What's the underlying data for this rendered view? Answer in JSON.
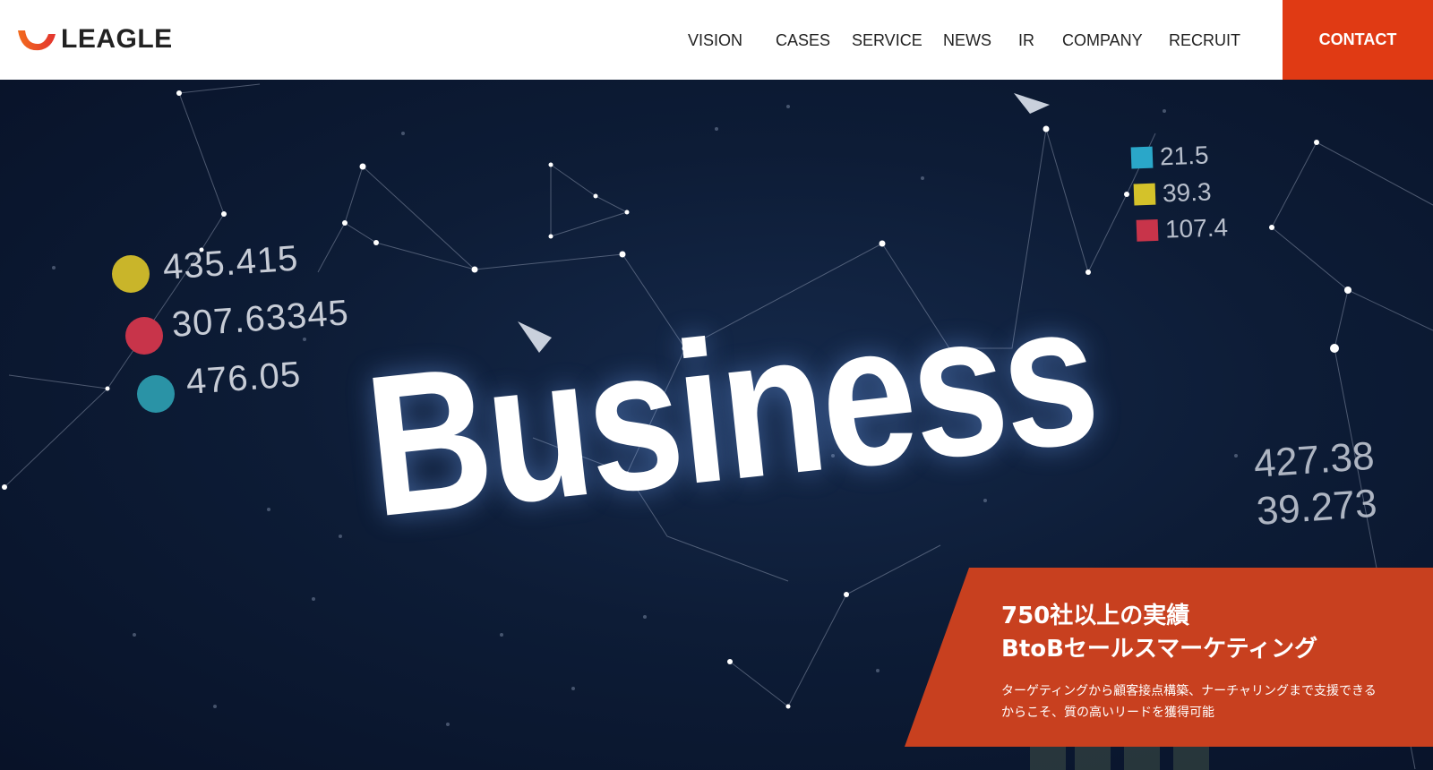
{
  "brand": {
    "name": "LEAGLE",
    "colors": {
      "accent": "#e03a14",
      "logo_orange": "#f26b1d",
      "logo_red": "#e3342f",
      "text": "#222222"
    }
  },
  "nav": {
    "items": [
      {
        "label": "VISION"
      },
      {
        "label": "CASES"
      },
      {
        "label": "SERVICE"
      },
      {
        "label": "NEWS"
      },
      {
        "label": "IR"
      },
      {
        "label": "COMPANY"
      },
      {
        "label": "RECRUIT"
      }
    ],
    "contact_label": "CONTACT"
  },
  "hero": {
    "headline_word": "Business",
    "stats": [
      {
        "value": "435.415",
        "color": "#c9b52a"
      },
      {
        "value": "307.63345",
        "color": "#c8344a"
      },
      {
        "value": "476.05",
        "color": "#2a93a6"
      }
    ],
    "mini_legend": [
      {
        "value": "21.5",
        "color": "#2aa7c9"
      },
      {
        "value": "39.3",
        "color": "#d4c22a"
      },
      {
        "value": "107.4",
        "color": "#c8344a"
      }
    ],
    "right_numbers": [
      "427.38",
      "39.273"
    ]
  },
  "promo": {
    "title_line1": "750社以上の実績",
    "title_line2": "BtoBセールスマーケティング",
    "body_line1": "ターゲティングから顧客接点構築、ナーチャリングまで支援できる",
    "body_line2": "からこそ、質の高いリードを獲得可能"
  }
}
